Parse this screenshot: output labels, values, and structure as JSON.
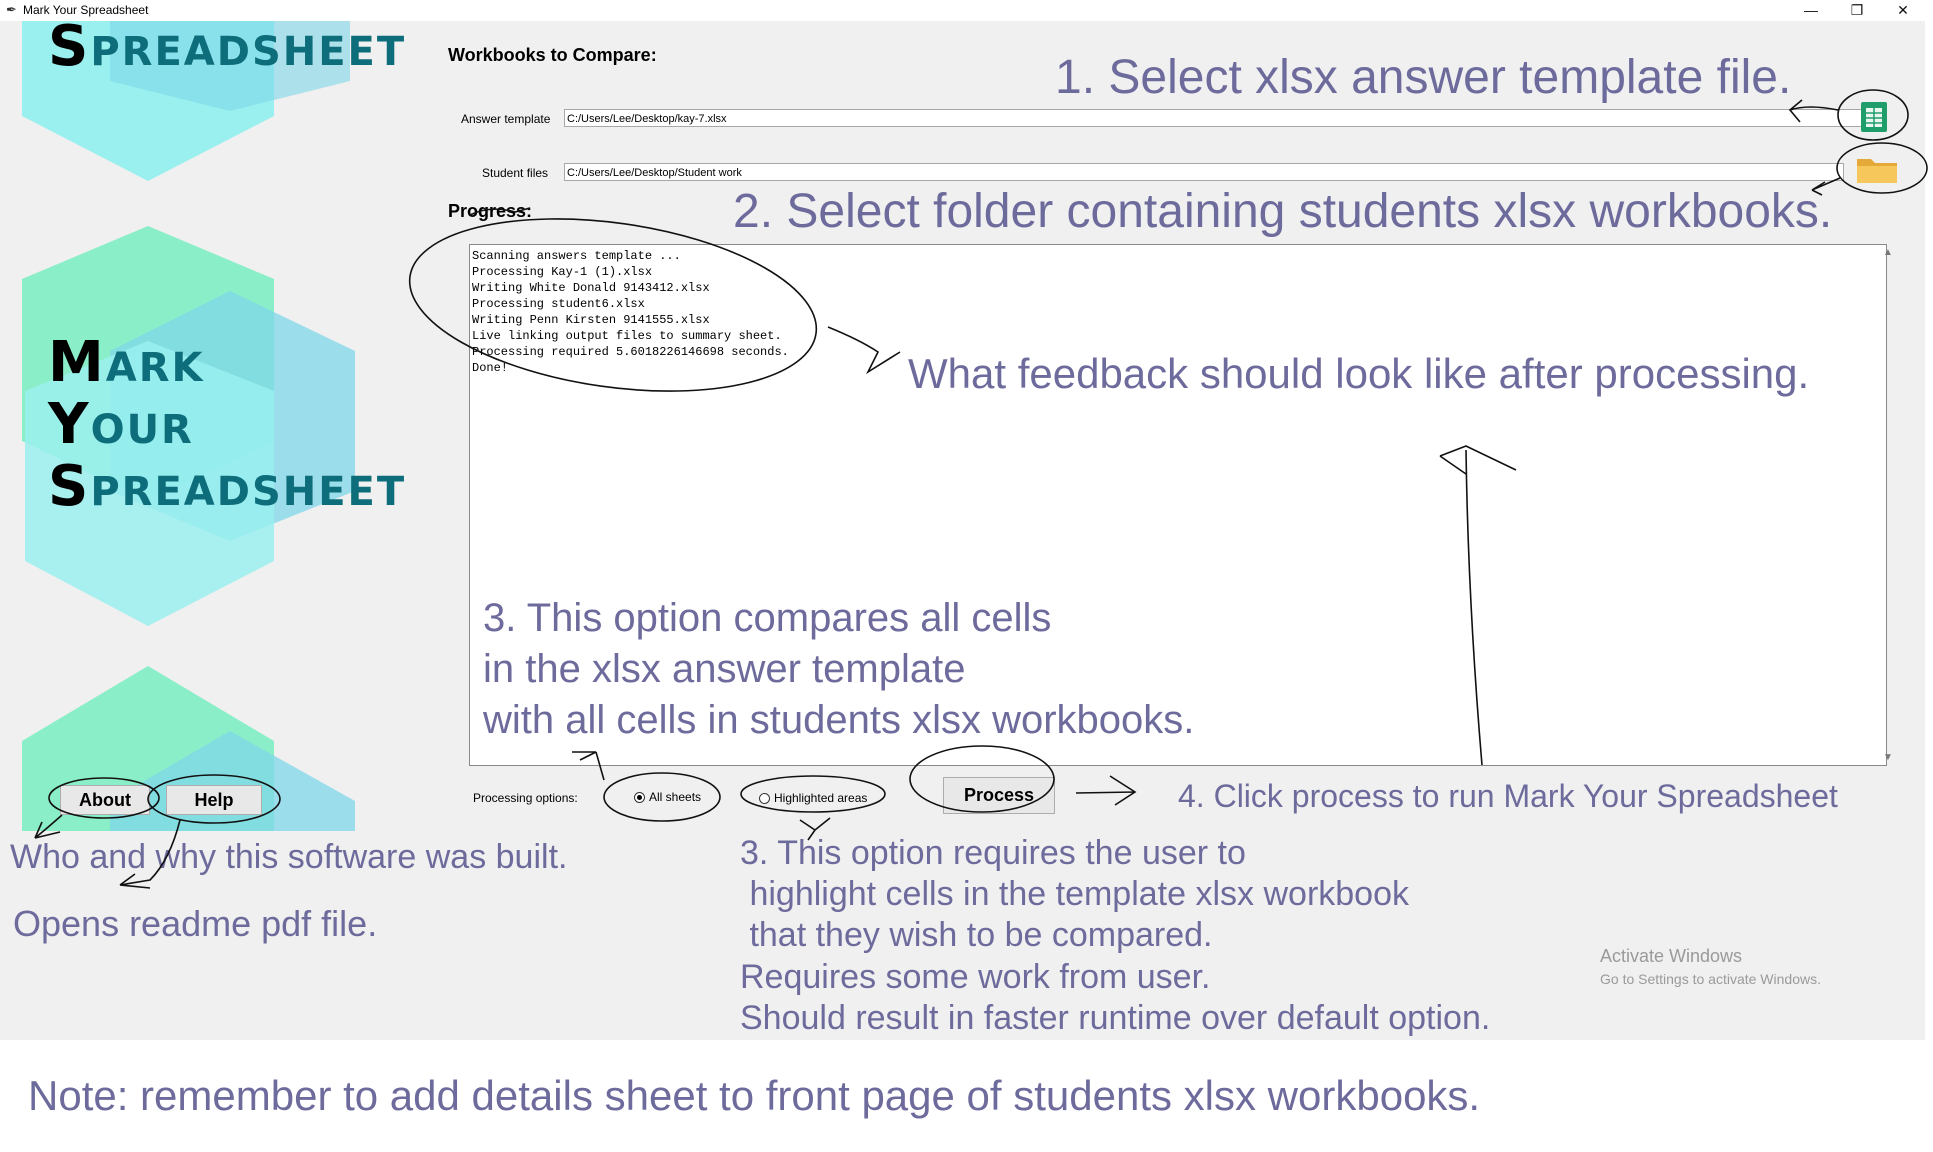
{
  "window": {
    "title": "Mark Your Spreadsheet",
    "minimize": "—",
    "restore": "❐",
    "close": "✕"
  },
  "logo": {
    "top_partial": {
      "cap": "S",
      "rest": "PREADSHEET"
    },
    "lines": [
      {
        "cap": "M",
        "rest": "ARK"
      },
      {
        "cap": "Y",
        "rest": "OUR"
      },
      {
        "cap": "S",
        "rest": "PREADSHEET"
      }
    ],
    "colors": {
      "hex_green": "#8aeec8",
      "hex_cyan": "#9af0ef",
      "hex_blue": "#7fd7ea",
      "text": "#0d6d7a"
    }
  },
  "form": {
    "heading": "Workbooks to Compare:",
    "answer_template_label": "Answer template",
    "answer_template_value": "C:/Users/Lee/Desktop/kay-7.xlsx",
    "student_files_label": "Student  files",
    "student_files_value": "C:/Users/Lee/Desktop/Student work",
    "spreadsheet_icon": "spreadsheet-icon",
    "folder_icon": "folder-icon"
  },
  "progress": {
    "heading": "Progress:",
    "log": [
      "Scanning answers template ...",
      "Processing Kay-1 (1).xlsx",
      "Writing White Donald 9143412.xlsx",
      "Processing student6.xlsx",
      "Writing Penn Kirsten 9141555.xlsx",
      "Live linking output files to summary sheet.",
      "Processing required 5.6018226146698 seconds.",
      "Done!"
    ]
  },
  "options": {
    "label": "Processing options:",
    "all_sheets": "All sheets",
    "highlighted_areas": "Highlighted areas",
    "selected": "All sheets",
    "process_button": "Process"
  },
  "footer_buttons": {
    "about": "About",
    "help": "Help"
  },
  "annotations": {
    "step1": "1. Select xlsx answer template file.",
    "step2": "2. Select folder containing students xlsx workbooks.",
    "feedback": "What feedback should look like after processing.",
    "step3_all": [
      "3. This option compares all cells",
      "in the xlsx answer template",
      "with all cells in students xlsx workbooks."
    ],
    "step4": "4. Click process to run Mark Your Spreadsheet",
    "step3_highlight": [
      "3. This option requires the user to",
      " highlight cells in the template xlsx workbook",
      " that they wish to be compared.",
      "Requires some work from user.",
      "Should result in faster runtime over default option."
    ],
    "about_note": "Who and why this software was built.",
    "help_note": "Opens readme pdf file.",
    "bottom_note": "Note: remember to add details sheet to front page of students xlsx workbooks.",
    "color": "#6d6a9c"
  },
  "watermark": {
    "line1": "Activate Windows",
    "line2": "Go to Settings to activate Windows."
  }
}
